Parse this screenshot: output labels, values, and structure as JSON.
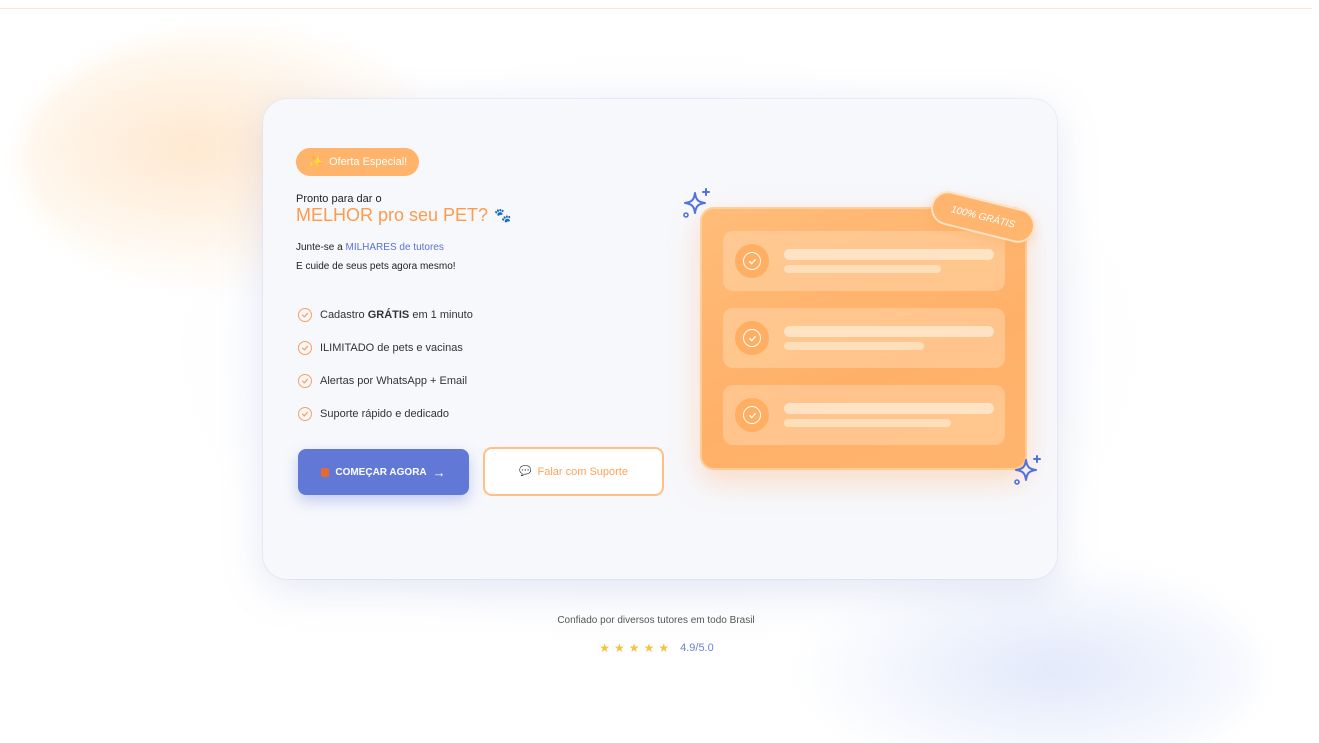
{
  "badge": {
    "label": "Oferta Especial!",
    "icon": "sparkles-icon"
  },
  "hero": {
    "intro": "Pronto para dar o",
    "headline": "MELHOR pro seu PET?",
    "headline_icon": "paw-icon",
    "join_prefix": "Junte-se a ",
    "join_accent": "MILHARES de tutores",
    "care": "E cuide de seus pets agora mesmo!"
  },
  "features": [
    {
      "pre": "Cadastro ",
      "bold": "GRÁTIS",
      "post": " em 1 minuto"
    },
    {
      "pre": "ILIMITADO de pets e vacinas",
      "bold": "",
      "post": ""
    },
    {
      "pre": "Alertas por WhatsApp + Email",
      "bold": "",
      "post": ""
    },
    {
      "pre": "Suporte rápido e dedicado",
      "bold": "",
      "post": ""
    }
  ],
  "buttons": {
    "primary": "COMEÇAR AGORA",
    "primary_arrow": "→",
    "secondary": "Falar com Suporte",
    "secondary_icon": "💬"
  },
  "illustration": {
    "free_badge": "100% GRÁTIS"
  },
  "footer": {
    "trust": "Confiado por diversos tutores em todo Brasil",
    "stars": 5,
    "rating": "4.9/5.0"
  },
  "colors": {
    "accent_orange": "#ff9a4a",
    "accent_blue": "#6178d6",
    "star": "#f5c242"
  }
}
